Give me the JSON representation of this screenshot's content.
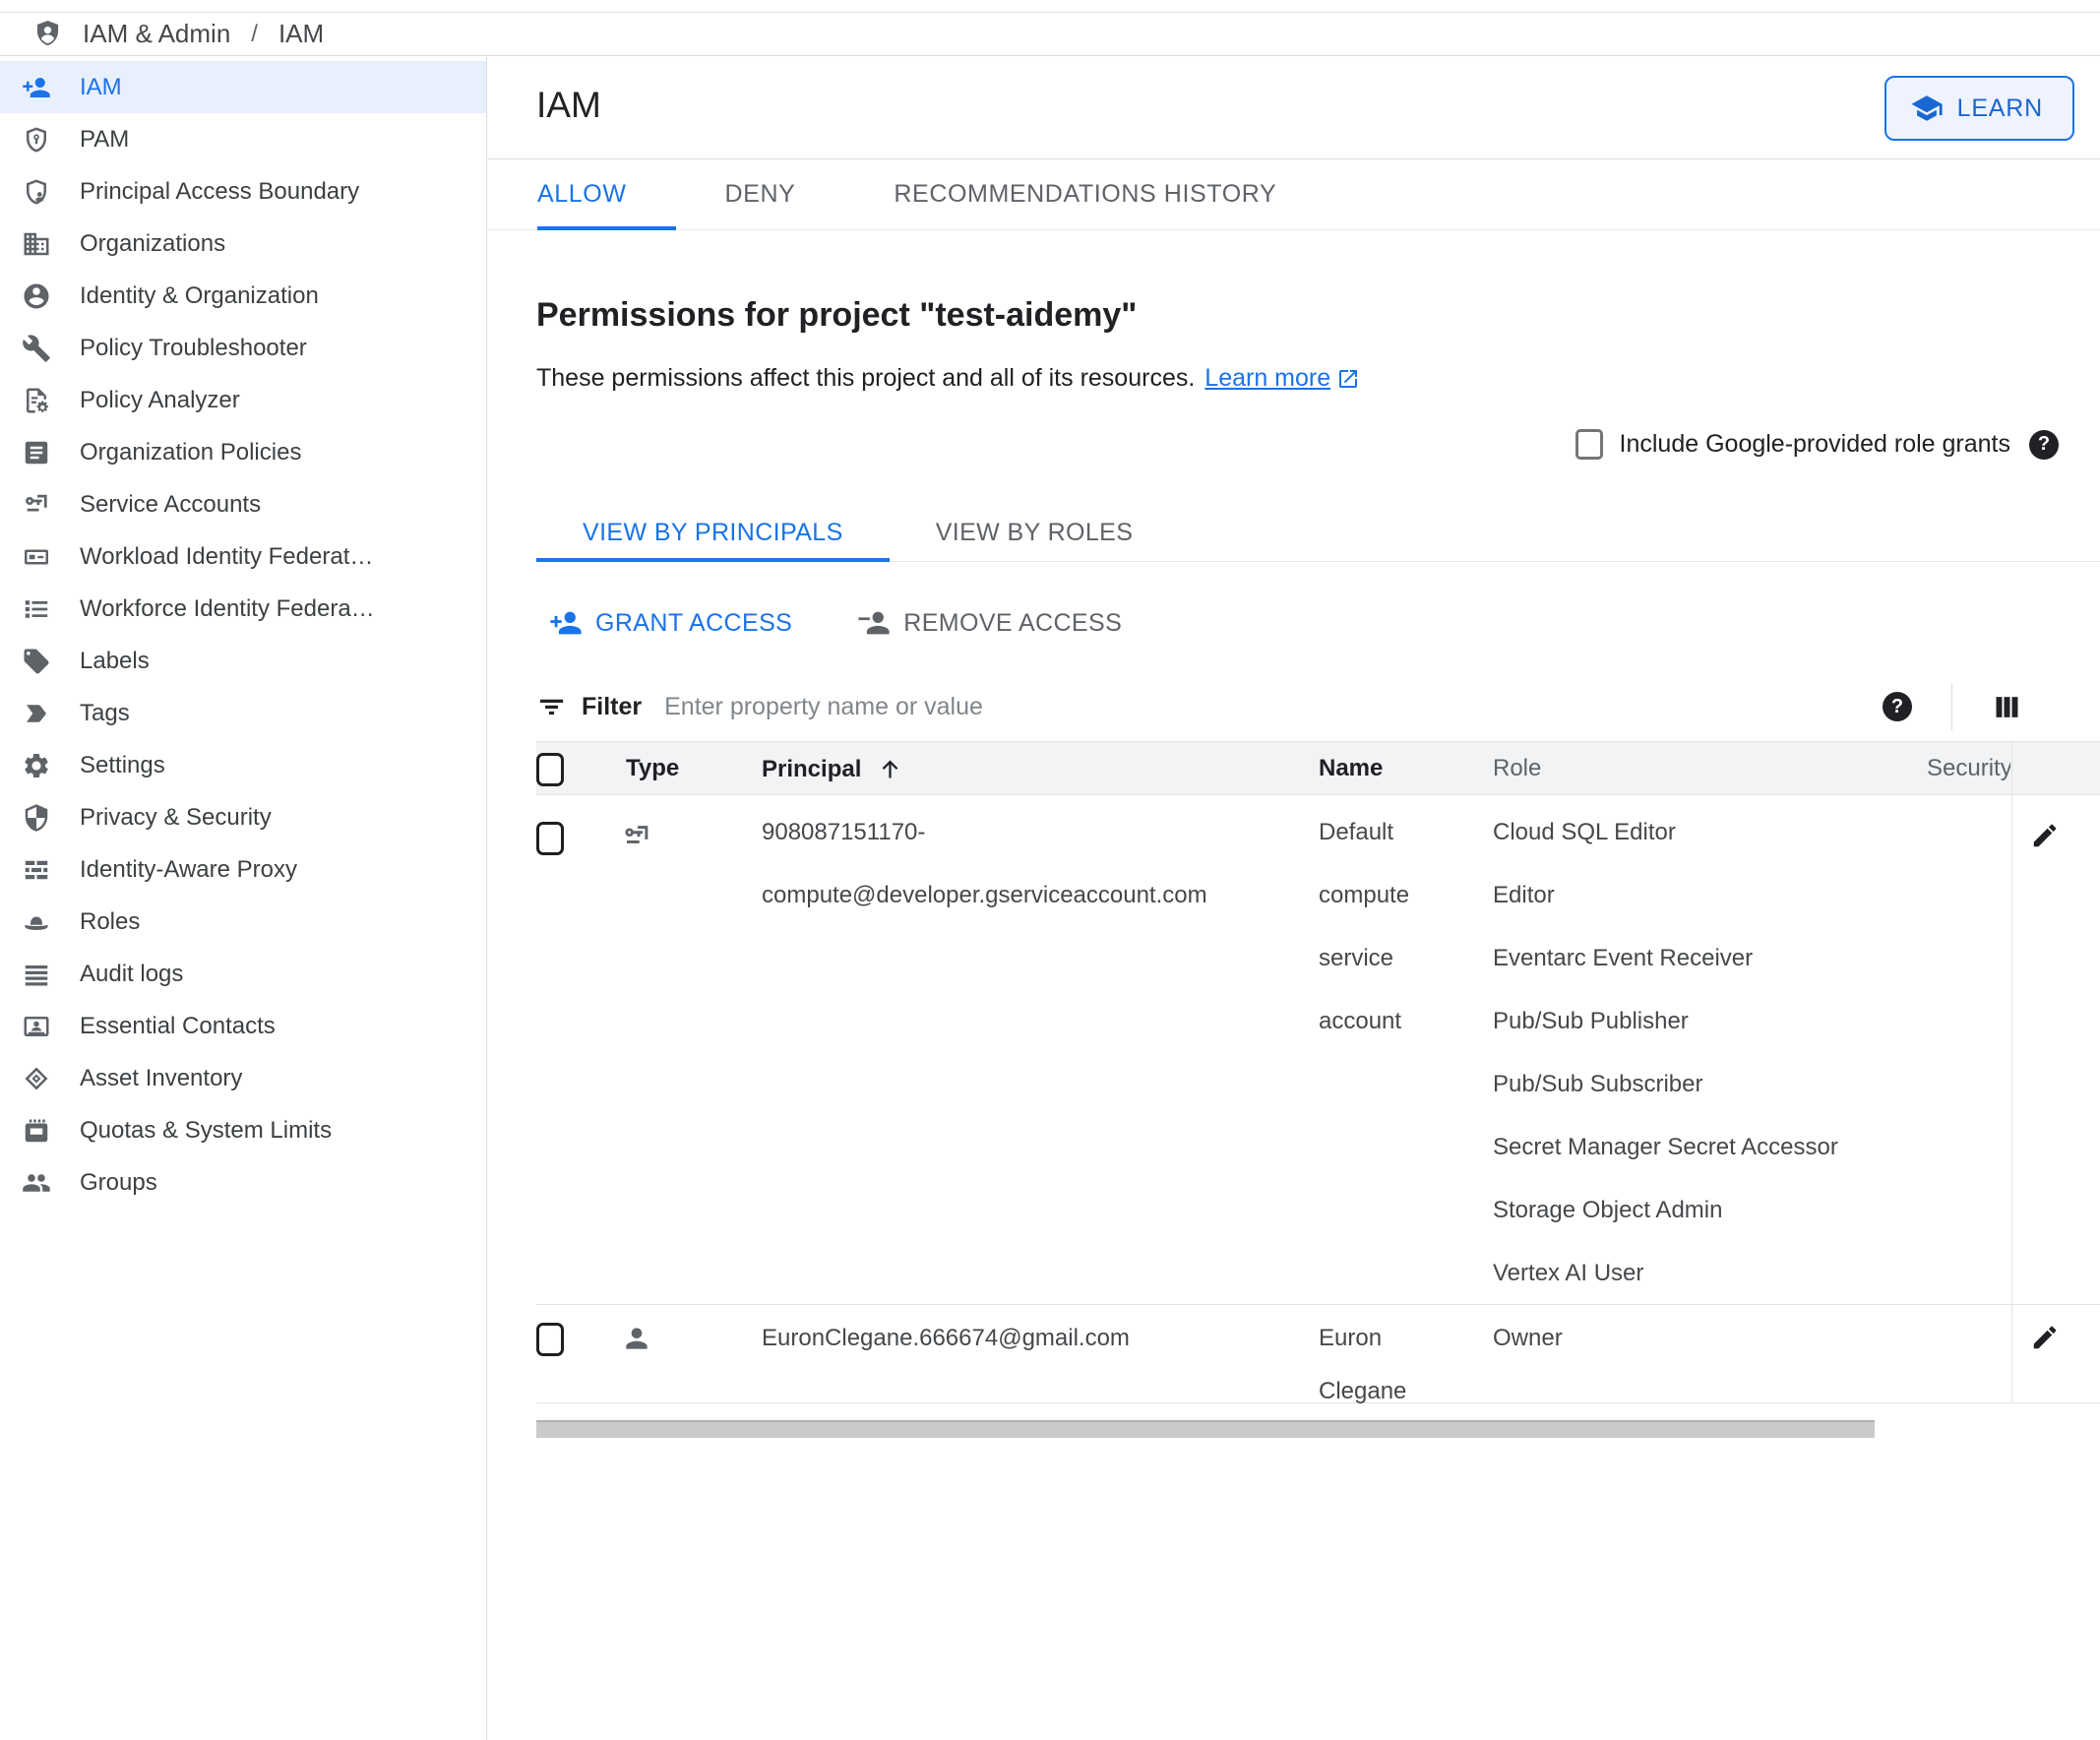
{
  "colors": {
    "accent": "#1a73e8",
    "selected_bg": "#e8f0fe",
    "text_primary": "#202124",
    "text_secondary": "#5f6368",
    "border": "#dadce0",
    "table_header_bg": "#f1f3f4"
  },
  "topbar": {
    "logo_icon": "iam-admin-shield-icon",
    "breadcrumb": {
      "section": "IAM & Admin",
      "separator": "/",
      "page": "IAM"
    }
  },
  "sidebar": {
    "items": [
      {
        "label": "IAM",
        "icon": "person-add-icon",
        "active": true
      },
      {
        "label": "PAM",
        "icon": "shield-key-icon"
      },
      {
        "label": "Principal Access Boundary",
        "icon": "shield-person-icon"
      },
      {
        "label": "Organizations",
        "icon": "organization-icon"
      },
      {
        "label": "Identity & Organization",
        "icon": "account-circle-icon"
      },
      {
        "label": "Policy Troubleshooter",
        "icon": "wrench-icon"
      },
      {
        "label": "Policy Analyzer",
        "icon": "document-gear-icon"
      },
      {
        "label": "Organization Policies",
        "icon": "document-lines-icon"
      },
      {
        "label": "Service Accounts",
        "icon": "service-account-key-icon"
      },
      {
        "label": "Workload Identity Federat…",
        "icon": "id-card-icon"
      },
      {
        "label": "Workforce Identity Federa…",
        "icon": "list-icon"
      },
      {
        "label": "Labels",
        "icon": "tag-icon"
      },
      {
        "label": "Tags",
        "icon": "label-arrow-icon"
      },
      {
        "label": "Settings",
        "icon": "gear-icon"
      },
      {
        "label": "Privacy & Security",
        "icon": "shield-half-icon"
      },
      {
        "label": "Identity-Aware Proxy",
        "icon": "brick-wall-icon"
      },
      {
        "label": "Roles",
        "icon": "hat-icon"
      },
      {
        "label": "Audit logs",
        "icon": "horizontal-lines-icon"
      },
      {
        "label": "Essential Contacts",
        "icon": "contact-card-icon"
      },
      {
        "label": "Asset Inventory",
        "icon": "nested-diamond-icon"
      },
      {
        "label": "Quotas & System Limits",
        "icon": "quota-icon"
      },
      {
        "label": "Groups",
        "icon": "people-icon"
      }
    ]
  },
  "main": {
    "title": "IAM",
    "learn_button": {
      "label": "LEARN",
      "icon": "mortarboard-icon"
    },
    "tabs": [
      {
        "label": "ALLOW",
        "active": true
      },
      {
        "label": "DENY",
        "active": false
      },
      {
        "label": "RECOMMENDATIONS HISTORY",
        "active": false
      }
    ],
    "heading": "Permissions for project \"test-aidemy\"",
    "subtitle": "These permissions affect this project and all of its resources.",
    "subtitle_link": "Learn more",
    "grants_checkbox": {
      "label": "Include Google-provided role grants",
      "checked": false
    },
    "view_tabs": [
      {
        "label": "VIEW BY PRINCIPALS",
        "active": true
      },
      {
        "label": "VIEW BY ROLES",
        "active": false
      }
    ],
    "actions": {
      "grant": "GRANT ACCESS",
      "remove": "REMOVE ACCESS"
    },
    "filter": {
      "label": "Filter",
      "placeholder": "Enter property name or value"
    },
    "table": {
      "columns": [
        "Type",
        "Principal",
        "Name",
        "Role",
        "Security"
      ],
      "sorted_column": "Principal",
      "rows": [
        {
          "type_icon": "service-account-icon",
          "principal": "908087151170-compute@developer.gserviceaccount.com",
          "name": "Default compute service account",
          "roles": [
            "Cloud SQL Editor",
            "Editor",
            "Eventarc Event Receiver",
            "Pub/Sub Publisher",
            "Pub/Sub Subscriber",
            "Secret Manager Secret Accessor",
            "Storage Object Admin",
            "Vertex AI User"
          ]
        },
        {
          "type_icon": "person-icon",
          "principal": "EuronClegane.666674@gmail.com",
          "name": "Euron Clegane",
          "roles": [
            "Owner"
          ]
        }
      ]
    }
  }
}
